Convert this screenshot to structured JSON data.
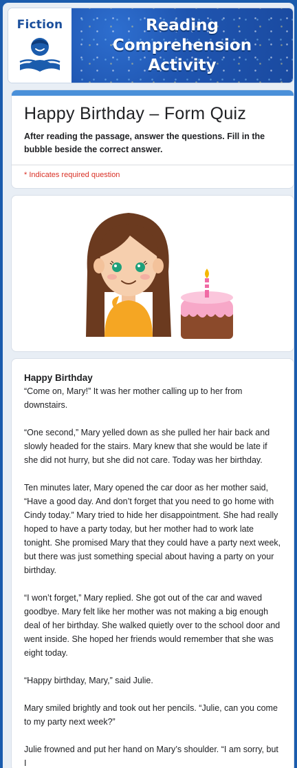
{
  "banner": {
    "tag": "Fiction",
    "title_lines": [
      "Reading",
      "Comprehension",
      "Activity"
    ],
    "icon": "reader-icon"
  },
  "quiz": {
    "title": "Happy Birthday – Form Quiz",
    "description": "After reading the passage, answer the questions. Fill in the bubble beside the correct answer.",
    "required_note": "* Indicates required question"
  },
  "illustration": {
    "subject": "girl-with-birthday-cake",
    "colors": {
      "hair": "#6b3a1f",
      "shirt": "#f5a623",
      "cake_icing": "#f7a8c8",
      "cake_body": "#8b4a2b"
    }
  },
  "passage": {
    "heading": "Happy Birthday",
    "paragraphs": [
      "“Come on, Mary!” It was her mother calling up to her from downstairs.",
      "“One second,” Mary yelled down as she pulled her hair back and slowly headed for the stairs. Mary knew that she would be late if she did not hurry, but she did not care. Today was her birthday.",
      "Ten minutes later, Mary opened the car door as her mother said, “Have a good day. And don’t forget that you need to go home with Cindy today.” Mary tried to hide her disappointment. She had really hoped to have a party today, but her mother had to work late tonight. She promised Mary that they could have a party next week, but there was just something special about having a party on your birthday.",
      "“I won’t forget,” Mary replied. She got out of the car and waved goodbye. Mary felt like her mother was not making a big enough deal of her birthday. She walked quietly over to the school door and went inside. She hoped her friends would remember that she was eight today.",
      "“Happy birthday, Mary,” said Julie.",
      "Mary smiled brightly and took out her pencils. “Julie, can you come to my party next week?”",
      "Julie frowned and put her hand on Mary’s shoulder. “I am sorry, but I"
    ]
  },
  "colors": {
    "frame": "#1b5cad",
    "accent": "#4a90d9",
    "required": "#d93025"
  }
}
